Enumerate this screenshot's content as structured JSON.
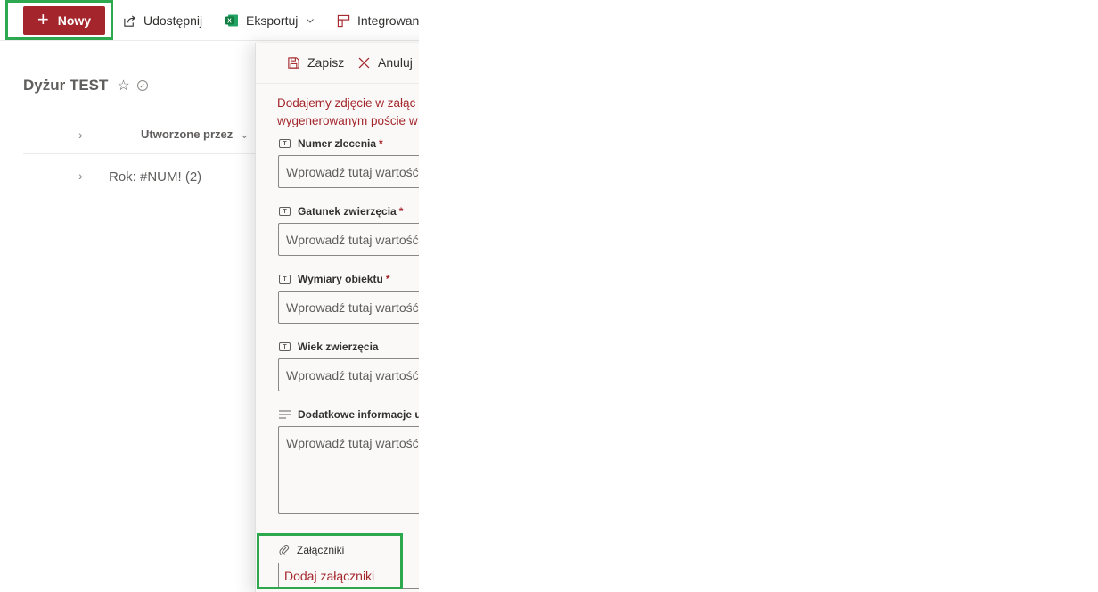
{
  "toolbar": {
    "new_label": "Nowy",
    "share_label": "Udostępnij",
    "export_label": "Eksportuj",
    "integrate_label": "Integrowan"
  },
  "list": {
    "title": "Dyżur TEST",
    "column_created_by": "Utworzone przez",
    "group_label": "Rok: #NUM! (2)"
  },
  "panel": {
    "save_label": "Zapisz",
    "cancel_label": "Anuluj",
    "notice_line1": "Dodajemy zdjęcie w załąc",
    "notice_line2": "wygenerowanym poście w",
    "fields": [
      {
        "label": "Numer zlecenia",
        "required": "*",
        "placeholder": "Wprowadź tutaj wartość"
      },
      {
        "label": "Gatunek zwierzęcia",
        "required": "*",
        "placeholder": "Wprowadź tutaj wartość"
      },
      {
        "label": "Wymiary obiektu",
        "required": "*",
        "placeholder": "Wprowadź tutaj wartość"
      },
      {
        "label": "Wiek zwierzęcia",
        "required": "",
        "placeholder": "Wprowadź tutaj wartość"
      },
      {
        "label": "Dodatkowe informacje ur",
        "required": "",
        "placeholder": "Wprowadź tutaj wartość"
      }
    ],
    "attachments_label": "Załączniki",
    "attachments_action": "Dodaj załączniki"
  },
  "colors": {
    "accent": "#a4262c",
    "highlight": "#2ea84f",
    "excel_green": "#107c41"
  }
}
